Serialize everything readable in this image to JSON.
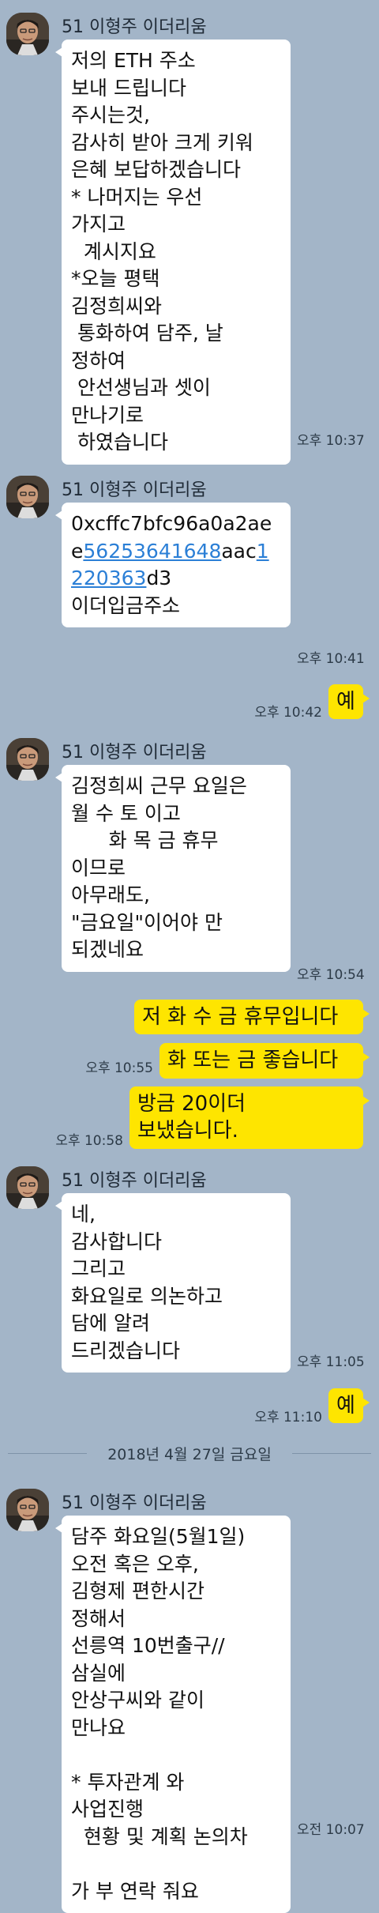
{
  "chat": {
    "messages": [
      {
        "type": "in",
        "sender": "51 이형주 이더리움",
        "lines": [
          "저의 ETH 주소",
          "보내 드립니다",
          "주시는것,",
          "감사히 받아 크게 키워",
          "은혜 보답하겠습니다",
          "* 나머지는 우선",
          "가지고",
          "  계시지요",
          "*오늘 평택",
          "김정희씨와",
          " 통화하여 담주, 날",
          "정하여",
          " 안선생님과 셋이",
          "만나기로",
          " 하였습니다"
        ],
        "time": "오후 10:37"
      },
      {
        "type": "in",
        "sender": "51 이형주 이더리움",
        "lines": [
          [
            {
              "t": "0xcffc7bfc96a0a2ae"
            }
          ],
          [
            {
              "t": "e"
            },
            {
              "t": "56253641648",
              "link": true
            },
            {
              "t": "aac"
            },
            {
              "t": "1",
              "link": true
            }
          ],
          [
            {
              "t": "220363",
              "link": true
            },
            {
              "t": "d3"
            }
          ],
          [
            {
              "t": "이더입금주소"
            }
          ]
        ],
        "time": "오후 10:41"
      },
      {
        "type": "out",
        "text": "예",
        "time": "오후 10:42"
      },
      {
        "type": "in",
        "sender": "51 이형주 이더리움",
        "lines": [
          "김정희씨 근무 요일은",
          "월 수 토 이고",
          "      화 목 금 휴무",
          "이므로",
          "아무래도,",
          "\"금요일\"이어야 만",
          "되겠네요"
        ],
        "time": "오후 10:54"
      },
      {
        "type": "out",
        "text": "저 화 수 금 휴무입니다",
        "time": ""
      },
      {
        "type": "out",
        "text": "화 또는 금 좋습니다",
        "time": "오후 10:55"
      },
      {
        "type": "out",
        "lines": [
          "방금 20이더",
          "보냈습니다."
        ],
        "time": "오후 10:58"
      },
      {
        "type": "in",
        "sender": "51 이형주 이더리움",
        "lines": [
          "네,",
          "감사합니다",
          "그리고",
          "화요일로 의논하고",
          "담에 알려",
          "드리겠습니다"
        ],
        "time": "오후 11:05"
      },
      {
        "type": "out",
        "text": "예",
        "time": "오후 11:10"
      },
      {
        "type": "date",
        "text": "2018년 4월 27일 금요일"
      },
      {
        "type": "in",
        "sender": "51 이형주 이더리움",
        "lines": [
          "담주 화요일(5월1일)",
          "오전 혹은 오후,",
          "김형제 편한시간",
          "정해서",
          "선릉역 10번출구//",
          "삼실에",
          "안상구씨와 같이",
          "만나요",
          "",
          "* 투자관계 와",
          "사업진행",
          "  현황 및 계획 논의차",
          "",
          "가 부 연락 줘요"
        ],
        "time": "오전 10:07"
      }
    ]
  }
}
